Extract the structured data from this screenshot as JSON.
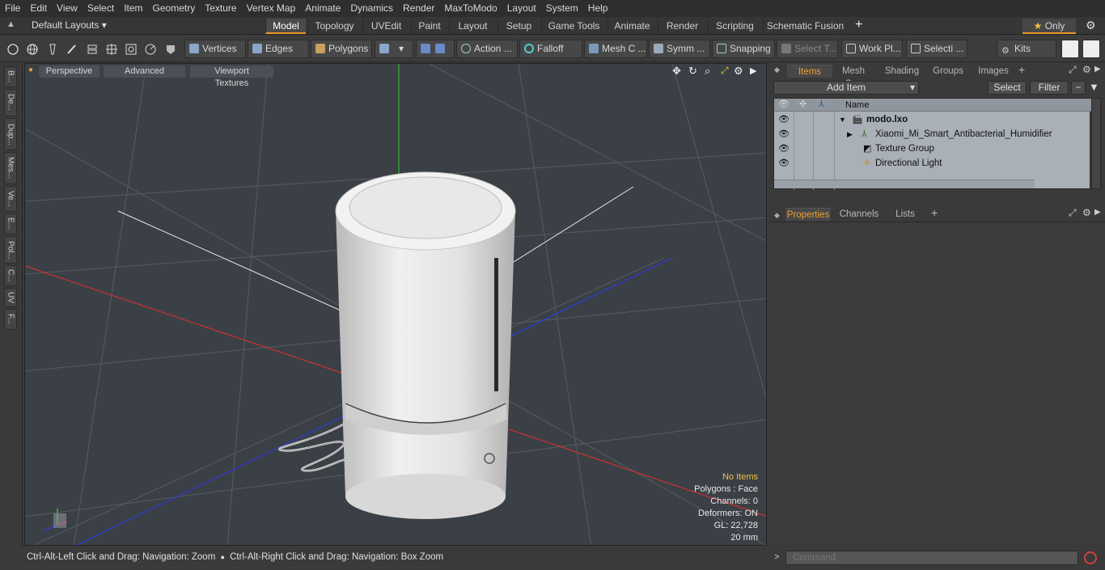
{
  "menu": [
    "File",
    "Edit",
    "View",
    "Select",
    "Item",
    "Geometry",
    "Texture",
    "Vertex Map",
    "Animate",
    "Dynamics",
    "Render",
    "MaxToModo",
    "Layout",
    "System",
    "Help"
  ],
  "layouts_label": "Default Layouts",
  "tabs": [
    "Model",
    "Topology",
    "UVEdit",
    "Paint",
    "Layout",
    "Setup",
    "Game Tools",
    "Animate",
    "Render",
    "Scripting",
    "Schematic Fusion"
  ],
  "only_label": "Only",
  "toolbar": {
    "vertices": "Vertices",
    "edges": "Edges",
    "polygons": "Polygons",
    "action": "Action ...",
    "falloff": "Falloff",
    "mesh": "Mesh C ...",
    "symm": "Symm ...",
    "snapping": "Snapping",
    "select_t": "Select T...",
    "work_pl": "Work Pl...",
    "selecti": "Selecti ...",
    "kits": "Kits"
  },
  "left_tabs": [
    "B...",
    "De...",
    "Dup...",
    "Mes...",
    "Ve...",
    "E...",
    "Pol...",
    "C...",
    "UV",
    "F..."
  ],
  "viewport": {
    "perspective": "Perspective",
    "advanced": "Advanced",
    "textures": "Viewport Textures",
    "hud": {
      "no_items": "No Items",
      "polygons": "Polygons : Face",
      "channels": "Channels: 0",
      "deformers": "Deformers: ON",
      "gl": "GL: 22,728",
      "scale": "20 mm"
    }
  },
  "items_panel": {
    "tabs": [
      "Items",
      "Mesh Ops",
      "Shading",
      "Groups",
      "Images"
    ],
    "add_item": "Add Item",
    "select": "Select",
    "filter": "Filter",
    "name_header": "Name",
    "rows": [
      "modo.lxo",
      "Xiaomi_Mi_Smart_Antibacterial_Humidifier",
      "Texture Group",
      "Directional Light"
    ]
  },
  "props_panel": {
    "tabs": [
      "Properties",
      "Channels",
      "Lists"
    ]
  },
  "status": {
    "left": "Ctrl-Alt-Left Click and Drag: Navigation: Zoom",
    "right": "Ctrl-Alt-Right Click and Drag: Navigation: Box Zoom"
  },
  "command_placeholder": "Command",
  "colors": {
    "accent": "#e89a2c",
    "grid": "#5a6068",
    "x_axis": "#c83232",
    "z_axis": "#2c3cdc",
    "y_axis": "#32c832"
  }
}
